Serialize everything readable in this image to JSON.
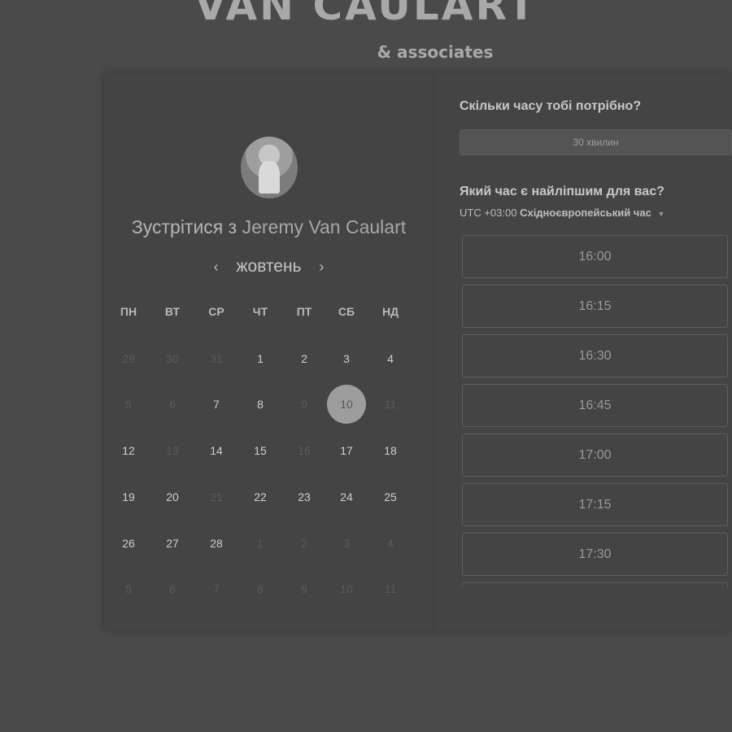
{
  "brand": {
    "title": "VAN CAULART",
    "subtitle": "& associates"
  },
  "scheduler": {
    "meet_prefix": "Зустрітися з",
    "host_name": "Jeremy Van Caulart",
    "month": "жовтень",
    "prev_arrow": "‹",
    "next_arrow": "›",
    "weekdays": [
      "ПН",
      "ВТ",
      "СР",
      "ЧТ",
      "ПТ",
      "СБ",
      "НД"
    ],
    "weeks": [
      [
        {
          "d": "29",
          "s": "off"
        },
        {
          "d": "30",
          "s": "off"
        },
        {
          "d": "31",
          "s": "off"
        },
        {
          "d": "1",
          "s": "on"
        },
        {
          "d": "2",
          "s": "on"
        },
        {
          "d": "3",
          "s": "on"
        },
        {
          "d": "4",
          "s": "on"
        }
      ],
      [
        {
          "d": "5",
          "s": "off"
        },
        {
          "d": "6",
          "s": "off"
        },
        {
          "d": "7",
          "s": "on"
        },
        {
          "d": "8",
          "s": "on"
        },
        {
          "d": "9",
          "s": "off"
        },
        {
          "d": "10",
          "s": "selected"
        },
        {
          "d": "11",
          "s": "off"
        }
      ],
      [
        {
          "d": "12",
          "s": "on"
        },
        {
          "d": "13",
          "s": "off"
        },
        {
          "d": "14",
          "s": "on"
        },
        {
          "d": "15",
          "s": "on"
        },
        {
          "d": "16",
          "s": "off"
        },
        {
          "d": "17",
          "s": "on"
        },
        {
          "d": "18",
          "s": "on"
        }
      ],
      [
        {
          "d": "19",
          "s": "on"
        },
        {
          "d": "20",
          "s": "on"
        },
        {
          "d": "21",
          "s": "off"
        },
        {
          "d": "22",
          "s": "on"
        },
        {
          "d": "23",
          "s": "on"
        },
        {
          "d": "24",
          "s": "on"
        },
        {
          "d": "25",
          "s": "on"
        }
      ],
      [
        {
          "d": "26",
          "s": "on"
        },
        {
          "d": "27",
          "s": "on"
        },
        {
          "d": "28",
          "s": "on"
        },
        {
          "d": "1",
          "s": "off"
        },
        {
          "d": "2",
          "s": "off"
        },
        {
          "d": "3",
          "s": "off"
        },
        {
          "d": "4",
          "s": "off"
        }
      ],
      [
        {
          "d": "5",
          "s": "off"
        },
        {
          "d": "6",
          "s": "off"
        },
        {
          "d": "7",
          "s": "off"
        },
        {
          "d": "8",
          "s": "off"
        },
        {
          "d": "9",
          "s": "off"
        },
        {
          "d": "10",
          "s": "off"
        },
        {
          "d": "11",
          "s": "off"
        }
      ]
    ]
  },
  "booking": {
    "duration_question": "Скільки часу тобі потрібно?",
    "duration_value": "30 хвилин",
    "time_question": "Який час є найліпшим для вас?",
    "tz_offset": "UTC +03:00",
    "tz_name": "Східноєвропейський час",
    "slots": [
      "16:00",
      "16:15",
      "16:30",
      "16:45",
      "17:00",
      "17:15",
      "17:30",
      ""
    ]
  }
}
